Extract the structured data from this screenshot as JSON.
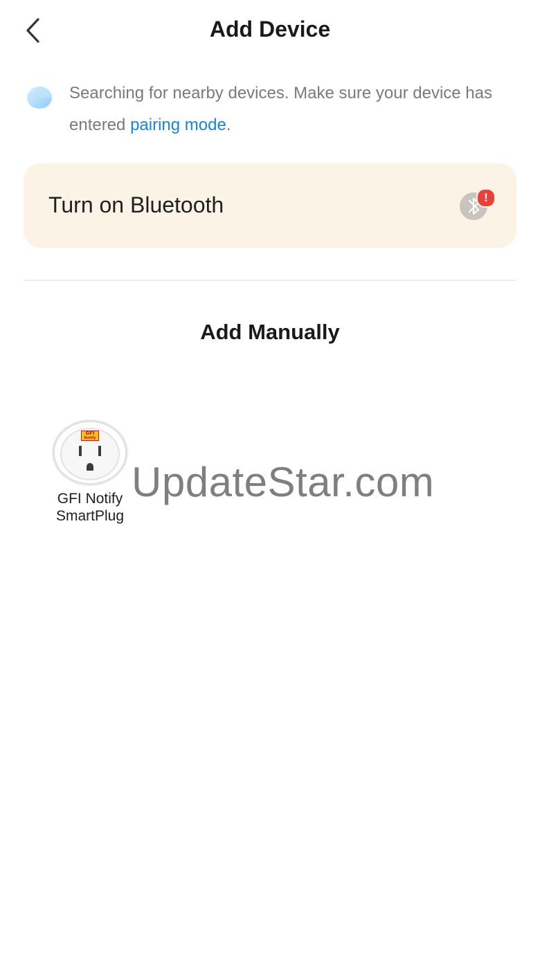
{
  "header": {
    "title": "Add Device"
  },
  "search": {
    "text_before_link": "Searching for nearby devices. Make sure your device has entered ",
    "link_label": "pairing mode",
    "text_after_link": "."
  },
  "bluetooth_card": {
    "label": "Turn on Bluetooth",
    "alert_symbol": "!"
  },
  "manual": {
    "title": "Add Manually",
    "devices": [
      {
        "name_line1": "GFI Notify",
        "name_line2": "SmartPlug",
        "badge_line1": "GFI",
        "badge_line2": "Notify"
      }
    ]
  },
  "watermark": "UpdateStar.com",
  "colors": {
    "link": "#1a84d6",
    "card_bg": "#fbf3e6",
    "alert": "#e8413c"
  }
}
